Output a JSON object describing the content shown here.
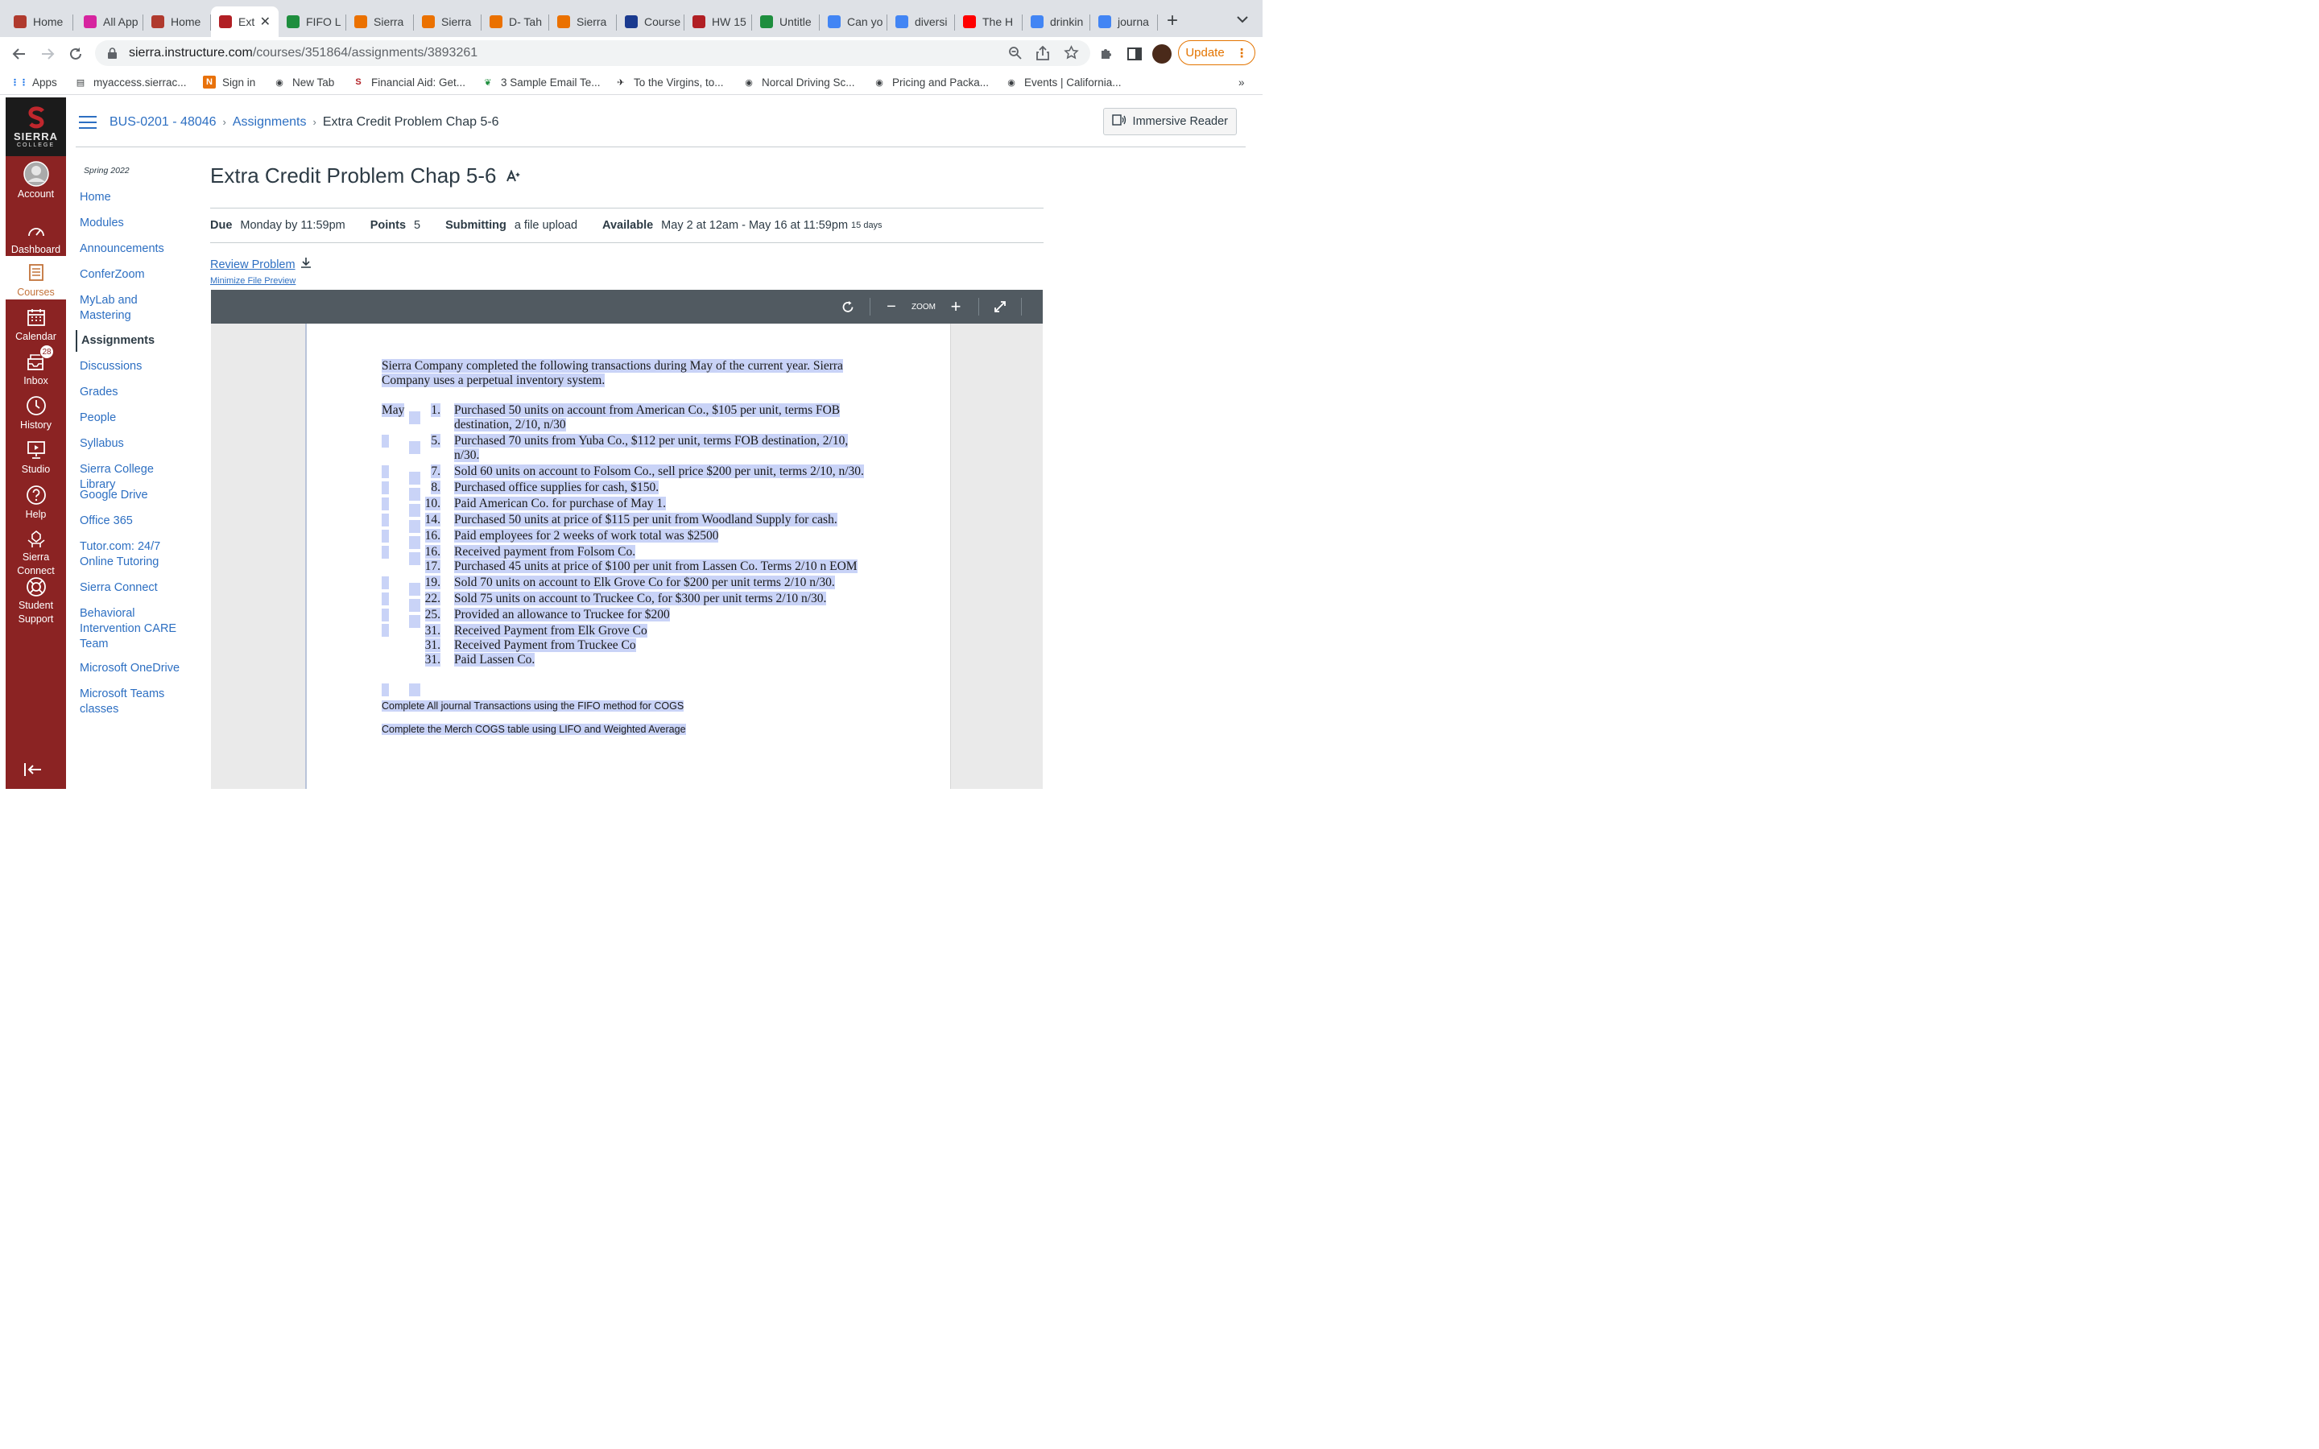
{
  "browser": {
    "tabs": [
      {
        "label": "Home",
        "icon": "canvas-house-icon",
        "color": "#b03a2e"
      },
      {
        "label": "All App",
        "icon": "instagram-icon",
        "color": "#d6249f"
      },
      {
        "label": "Home",
        "icon": "canvas-house-icon",
        "color": "#b03a2e"
      },
      {
        "label": "Ext",
        "icon": "sierra-icon",
        "color": "#b11f24",
        "active": true
      },
      {
        "label": "FIFO L",
        "icon": "sheets-plus-icon",
        "color": "#1e8e3e"
      },
      {
        "label": "Sierra",
        "icon": "chegg-icon",
        "color": "#eb7100"
      },
      {
        "label": "Sierra",
        "icon": "chegg-icon",
        "color": "#eb7100"
      },
      {
        "label": "D- Tah",
        "icon": "chegg-icon",
        "color": "#eb7100"
      },
      {
        "label": "Sierra",
        "icon": "chegg-icon",
        "color": "#eb7100"
      },
      {
        "label": "Course",
        "icon": "star-badge-icon",
        "color": "#1a3a8f"
      },
      {
        "label": "HW 15",
        "icon": "sierra-icon",
        "color": "#b11f24"
      },
      {
        "label": "Untitle",
        "icon": "sheets-plus-icon",
        "color": "#1e8e3e"
      },
      {
        "label": "Can yo",
        "icon": "google-icon",
        "color": "#4285f4"
      },
      {
        "label": "diversi",
        "icon": "google-icon",
        "color": "#4285f4"
      },
      {
        "label": "The H",
        "icon": "youtube-icon",
        "color": "#ff0000"
      },
      {
        "label": "drinkin",
        "icon": "google-icon",
        "color": "#4285f4"
      },
      {
        "label": "journa",
        "icon": "google-icon",
        "color": "#4285f4"
      }
    ],
    "new_tab": "+",
    "url_domain": "sierra.instructure.com",
    "url_path": "/courses/351864/assignments/3893261",
    "update_label": "Update",
    "bookmarks": [
      {
        "label": "Apps",
        "icon": "apps-grid-icon"
      },
      {
        "label": "myaccess.sierrac...",
        "icon": "doc-icon"
      },
      {
        "label": "Sign in",
        "icon": "n-icon"
      },
      {
        "label": "New Tab",
        "icon": "globe-icon"
      },
      {
        "label": "Financial Aid: Get...",
        "icon": "sierra-s-icon"
      },
      {
        "label": "3 Sample Email Te...",
        "icon": "flag-icon"
      },
      {
        "label": "To the Virgins, to...",
        "icon": "bird-icon"
      },
      {
        "label": "Norcal Driving Sc...",
        "icon": "globe-icon"
      },
      {
        "label": "Pricing and Packa...",
        "icon": "globe-icon"
      },
      {
        "label": "Events | California...",
        "icon": "globe-icon"
      }
    ],
    "more_bookmarks": "»"
  },
  "global_nav": {
    "logo_text": "SIERRA",
    "logo_sub": "COLLEGE",
    "items": [
      {
        "label": "Account",
        "icon": "avatar-icon"
      },
      {
        "label": "Dashboard",
        "icon": "dashboard-gauge-icon"
      },
      {
        "label": "Courses",
        "icon": "book-icon",
        "active": true
      },
      {
        "label": "Calendar",
        "icon": "calendar-icon"
      },
      {
        "label": "Inbox",
        "icon": "inbox-icon",
        "badge": "28"
      },
      {
        "label": "History",
        "icon": "clock-icon"
      },
      {
        "label": "Studio",
        "icon": "studio-icon"
      },
      {
        "label": "Help",
        "icon": "help-icon"
      },
      {
        "label": "Sierra Connect",
        "icon": "connect-icon"
      },
      {
        "label": "Student Support",
        "icon": "lifebuoy-icon"
      }
    ],
    "collapse_icon": "collapse-arrow-icon"
  },
  "header": {
    "breadcrumbs": [
      "BUS-0201 - 48046",
      "Assignments",
      "Extra Credit Problem Chap 5-6"
    ],
    "immersive_reader": "Immersive Reader"
  },
  "course_nav": {
    "term": "Spring 2022",
    "items": [
      "Home",
      "Modules",
      "Announcements",
      "ConferZoom",
      "MyLab and Mastering",
      "Assignments",
      "Discussions",
      "Grades",
      "People",
      "Syllabus",
      "Sierra College Library",
      "Google Drive",
      "Office 365",
      "Tutor.com: 24/7 Online Tutoring",
      "Sierra Connect",
      "Behavioral Intervention CARE Team",
      "Microsoft OneDrive",
      "Microsoft Teams classes"
    ],
    "active": "Assignments"
  },
  "assignment": {
    "title": "Extra Credit Problem Chap 5-6",
    "due_label": "Due",
    "due_value": "Monday by 11:59pm",
    "points_label": "Points",
    "points_value": "5",
    "submitting_label": "Submitting",
    "submitting_value": "a file upload",
    "available_label": "Available",
    "available_value": "May 2 at 12am - May 16 at 11:59pm",
    "available_days": "15 days",
    "review_link": "Review Problem",
    "minimize_link": "Minimize File Preview"
  },
  "viewer": {
    "zoom_label": "ZOOM",
    "zoom_out": "−",
    "zoom_in": "+"
  },
  "document": {
    "intro_1": "Sierra Company completed the following transactions during May of the current year. Sierra",
    "intro_2": "Company uses a perpetual inventory system.",
    "month": "May",
    "transactions": [
      {
        "day": "1.",
        "lines": [
          "Purchased 50 units on account from American Co., $105 per unit, terms FOB",
          "destination, 2/10, n/30"
        ]
      },
      {
        "day": "5.",
        "lines": [
          "Purchased 70 units from Yuba Co., $112 per unit, terms FOB destination, 2/10,",
          "n/30."
        ]
      },
      {
        "day": "7.",
        "lines": [
          "Sold 60 units on account to Folsom Co., sell price $200 per unit, terms 2/10, n/30."
        ]
      },
      {
        "day": "8.",
        "lines": [
          "Purchased office supplies for cash, $150."
        ]
      },
      {
        "day": "10.",
        "lines": [
          "Paid American Co. for purchase of May 1."
        ]
      },
      {
        "day": "14.",
        "lines": [
          "Purchased 50 units at price of $115 per unit from Woodland Supply for cash."
        ]
      },
      {
        "day": "16.",
        "lines": [
          "Paid employees for 2 weeks of work total was $2500"
        ]
      },
      {
        "day": "16.",
        "lines": [
          "Received payment from Folsom Co."
        ]
      },
      {
        "day": "17.",
        "lines": [
          "Purchased 45 units at price of $100 per unit from Lassen Co.  Terms 2/10 n EOM"
        ]
      },
      {
        "day": "19.",
        "lines": [
          "Sold 70 units on account to Elk Grove Co for $200 per unit terms 2/10 n/30."
        ]
      },
      {
        "day": "22.",
        "lines": [
          "Sold 75 units on account to Truckee Co, for $300 per unit terms 2/10 n/30."
        ]
      },
      {
        "day": "25.",
        "lines": [
          "Provided an allowance to Truckee for $200"
        ]
      },
      {
        "day": "31.",
        "lines": [
          "Received Payment from Elk Grove Co"
        ]
      },
      {
        "day": "31.",
        "lines": [
          "Received Payment from Truckee Co"
        ]
      },
      {
        "day": "31.",
        "lines": [
          "Paid Lassen Co."
        ]
      }
    ],
    "instruction_1": "Complete All journal Transactions using the FIFO method for COGS",
    "instruction_2": "Complete the Merch COGS table using LIFO and Weighted Average"
  }
}
